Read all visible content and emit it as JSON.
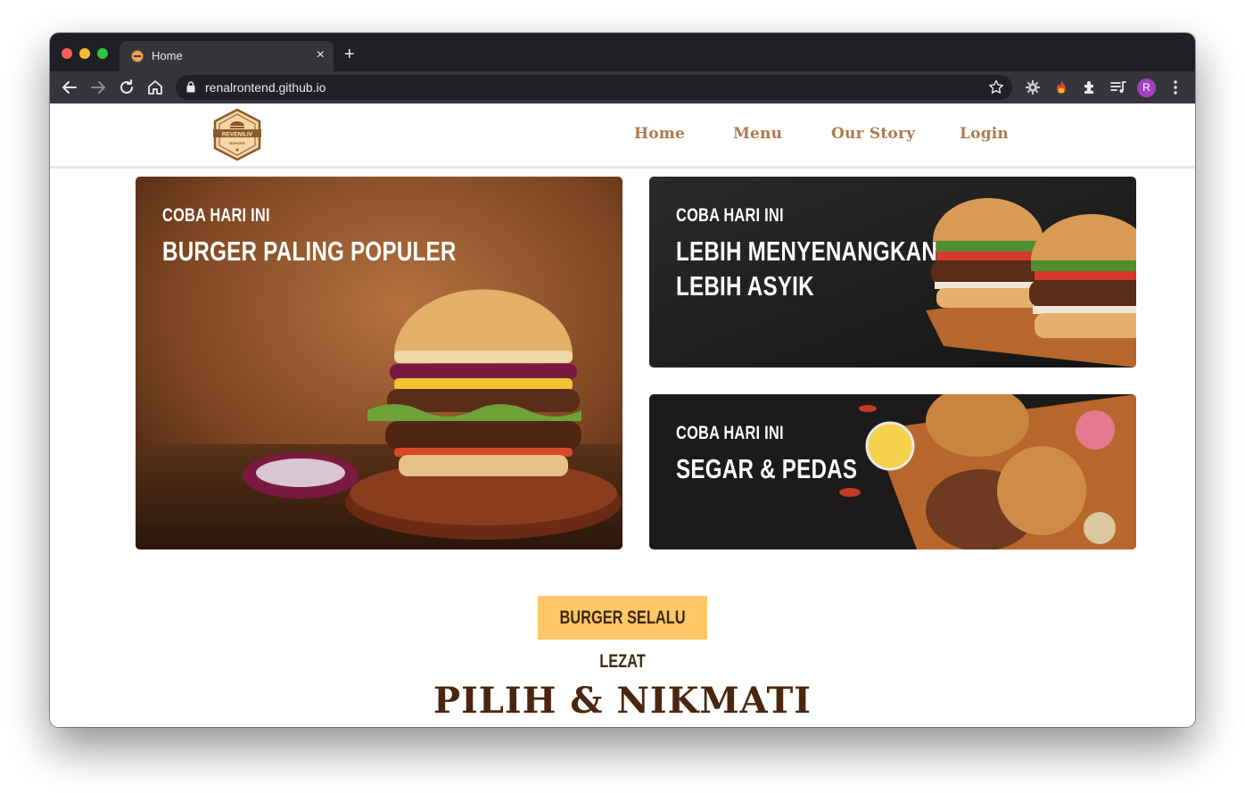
{
  "browser": {
    "tab": {
      "title": "Home",
      "close_glyph": "×"
    },
    "new_tab_glyph": "+",
    "url": "renalrontend.github.io",
    "profile_initial": "R"
  },
  "site": {
    "logo": {
      "brand": "REVENILIV",
      "sub": "BURGER"
    },
    "nav": [
      {
        "label": "Home"
      },
      {
        "label": "Menu"
      },
      {
        "label": "Our Story"
      },
      {
        "label": "Login"
      }
    ],
    "cards": [
      {
        "kicker": "COBA HARI INI",
        "title_lines": [
          "BURGER PALING POPULER"
        ]
      },
      {
        "kicker": "COBA HARI INI",
        "title_lines": [
          "LEBIH MENYENANGKAN",
          "LEBIH ASYIK"
        ]
      },
      {
        "kicker": "COBA HARI INI",
        "title_lines": [
          "SEGAR & PEDAS"
        ]
      }
    ],
    "cta_label": "BURGER SELALU LEZAT",
    "section_heading": "PILIH & NIKMATI"
  },
  "colors": {
    "nav_text": "#b07a4f",
    "cta_bg": "#ffc766",
    "heading": "#4a2610"
  }
}
